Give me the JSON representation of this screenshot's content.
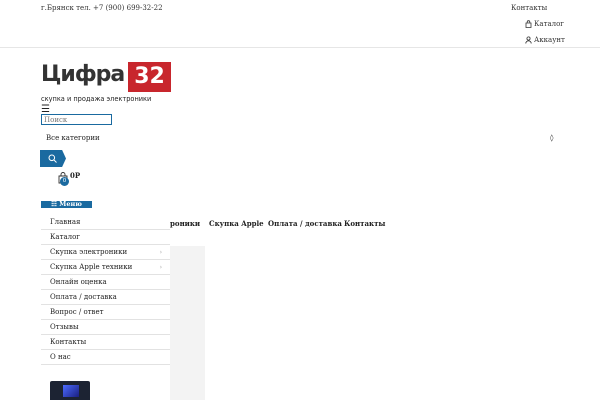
{
  "top": {
    "city_phone": "г.Брянск тел. +7 (900) 699-32-22",
    "contacts": "Контакты",
    "catalog": "Каталог",
    "account": "Аккаунт"
  },
  "logo": {
    "main": "Цифра",
    "num": "32",
    "sub": "скупка и продажа электроники"
  },
  "header": {
    "burger": "☰",
    "search_placeholder": "Поиск",
    "categories": "Все категории",
    "categories_arrow": "◊",
    "cart_count": "0",
    "cart_sum": "0Р"
  },
  "menu": {
    "button": "☷ Меню",
    "items": [
      {
        "label": "Главная",
        "chev": ""
      },
      {
        "label": "Каталог",
        "chev": ""
      },
      {
        "label": "Скупка электроники",
        "chev": "›"
      },
      {
        "label": "Скупка Apple техники",
        "chev": "›"
      },
      {
        "label": "Онлайн оценка",
        "chev": ""
      },
      {
        "label": "Оплата / доставка",
        "chev": ""
      },
      {
        "label": "Вопрос / ответ",
        "chev": ""
      },
      {
        "label": "Отзывы",
        "chev": ""
      },
      {
        "label": "Контакты",
        "chev": ""
      },
      {
        "label": "О нас",
        "chev": ""
      }
    ]
  },
  "nav": {
    "electronics_partial": "роники",
    "apple": "Скупка Apple",
    "payment": "Оплата / доставка",
    "contacts": "Контакты"
  },
  "colors": {
    "accent": "#1a6aa0",
    "logo_red": "#c8262d"
  }
}
